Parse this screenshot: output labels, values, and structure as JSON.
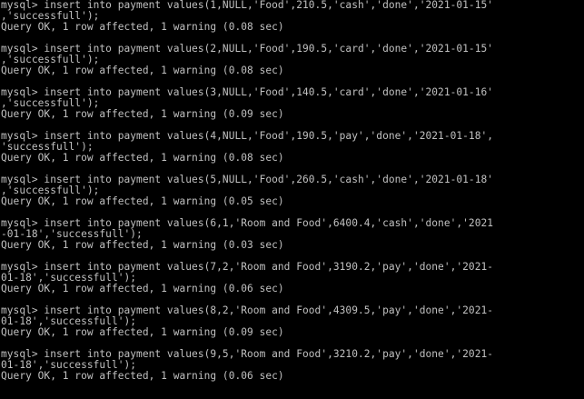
{
  "terminal": {
    "blocks": [
      {
        "command_lines": [
          "mysql> insert into payment values(1,NULL,'Food',210.5,'cash','done','2021-01-15'",
          ",'successfull');"
        ],
        "result": "Query OK, 1 row affected, 1 warning (0.08 sec)"
      },
      {
        "command_lines": [
          "mysql> insert into payment values(2,NULL,'Food',190.5,'card','done','2021-01-15'",
          ",'successfull');"
        ],
        "result": "Query OK, 1 row affected, 1 warning (0.08 sec)"
      },
      {
        "command_lines": [
          "mysql> insert into payment values(3,NULL,'Food',140.5,'card','done','2021-01-16'",
          ",'successfull');"
        ],
        "result": "Query OK, 1 row affected, 1 warning (0.09 sec)"
      },
      {
        "command_lines": [
          "mysql> insert into payment values(4,NULL,'Food',190.5,'pay','done','2021-01-18',",
          "'successfull');"
        ],
        "result": "Query OK, 1 row affected, 1 warning (0.08 sec)"
      },
      {
        "command_lines": [
          "mysql> insert into payment values(5,NULL,'Food',260.5,'cash','done','2021-01-18'",
          ",'successfull');"
        ],
        "result": "Query OK, 1 row affected, 1 warning (0.05 sec)"
      },
      {
        "command_lines": [
          "mysql> insert into payment values(6,1,'Room and Food',6400.4,'cash','done','2021",
          "-01-18','successfull');"
        ],
        "result": "Query OK, 1 row affected, 1 warning (0.03 sec)"
      },
      {
        "command_lines": [
          "mysql> insert into payment values(7,2,'Room and Food',3190.2,'pay','done','2021-",
          "01-18','successfull');"
        ],
        "result": "Query OK, 1 row affected, 1 warning (0.06 sec)"
      },
      {
        "command_lines": [
          "mysql> insert into payment values(8,2,'Room and Food',4309.5,'pay','done','2021-",
          "01-18','successfull');"
        ],
        "result": "Query OK, 1 row affected, 1 warning (0.09 sec)"
      },
      {
        "command_lines": [
          "mysql> insert into payment values(9,5,'Room and Food',3210.2,'pay','done','2021-",
          "01-18','successfull');"
        ],
        "result": "Query OK, 1 row affected, 1 warning (0.06 sec)"
      }
    ],
    "colors": {
      "background": "#000000",
      "text": "#c0c0c0"
    }
  }
}
